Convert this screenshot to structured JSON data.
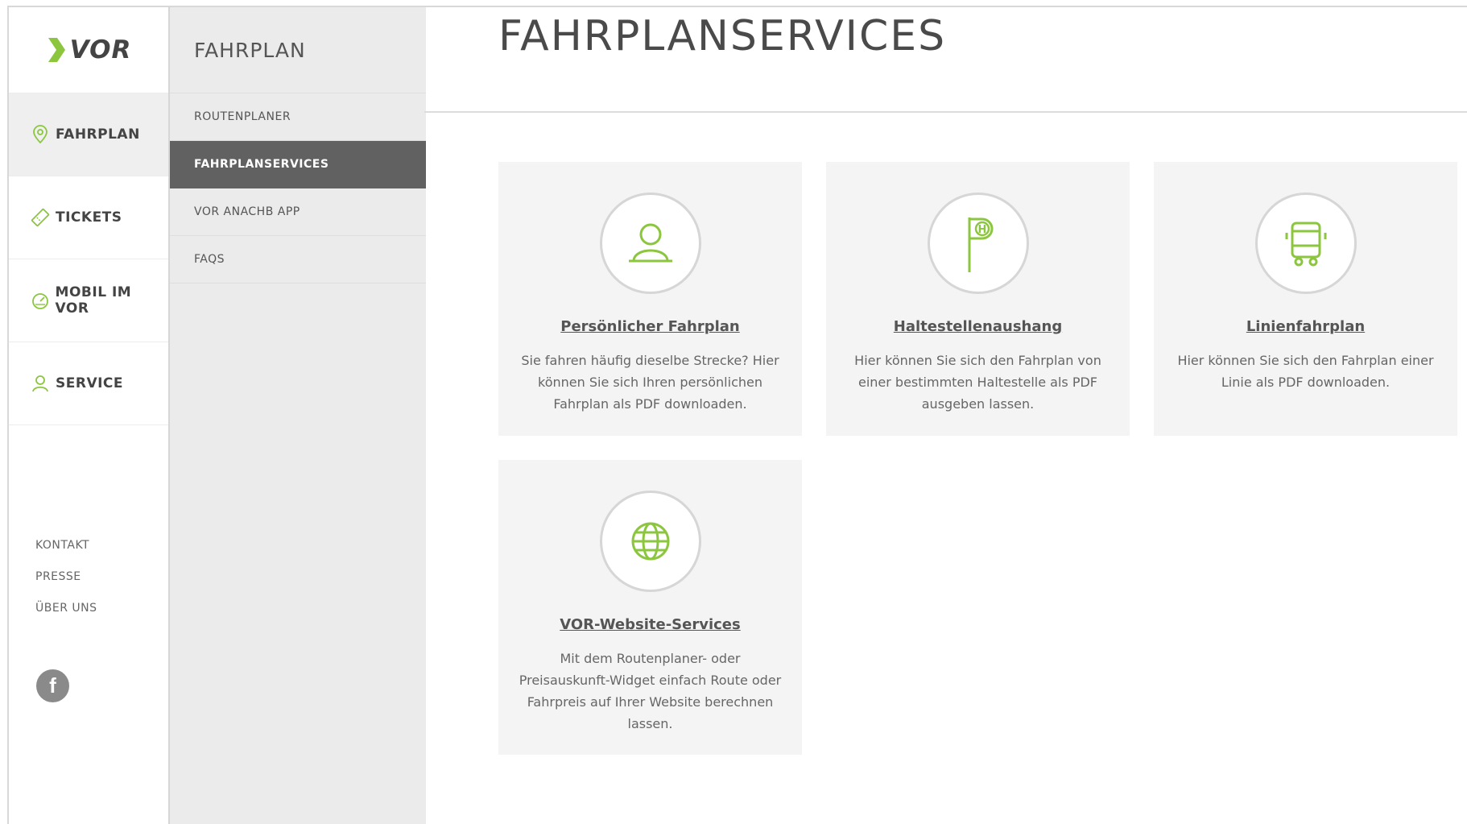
{
  "brand": {
    "logo_text": "VOR",
    "accent": "#8cc63f"
  },
  "primary_nav": [
    {
      "label": "FAHRPLAN",
      "icon": "location-pin-icon",
      "active": true
    },
    {
      "label": "TICKETS",
      "icon": "ticket-icon",
      "active": false
    },
    {
      "label": "MOBIL IM VOR",
      "icon": "speedometer-icon",
      "active": false
    },
    {
      "label": "SERVICE",
      "icon": "person-icon",
      "active": false
    }
  ],
  "footer_links": [
    "KONTAKT",
    "PRESSE",
    "ÜBER UNS"
  ],
  "social": {
    "facebook": "f"
  },
  "subnav": {
    "title": "FAHRPLAN",
    "items": [
      {
        "label": "ROUTENPLANER",
        "active": false
      },
      {
        "label": "FAHRPLANSERVICES",
        "active": true
      },
      {
        "label": "VOR ANACHB APP",
        "active": false
      },
      {
        "label": "FAQS",
        "active": false
      }
    ]
  },
  "main": {
    "title": "FAHRPLANSERVICES",
    "cards": [
      {
        "title": "Persönlicher Fahrplan",
        "icon": "person-icon",
        "desc": "Sie fahren häufig dieselbe Strecke? Hier können Sie sich Ihren persönlichen Fahrplan als PDF downloaden."
      },
      {
        "title": "Haltestellenaushang",
        "icon": "bus-stop-sign-icon",
        "icon_text": "H",
        "desc": "Hier können Sie sich den Fahrplan von einer bestimmten Haltestelle als PDF ausgeben lassen."
      },
      {
        "title": "Linienfahrplan",
        "icon": "bus-icon",
        "desc": "Hier können Sie sich den Fahrplan einer Linie als PDF downloaden."
      },
      {
        "title": "VOR-Website-Services",
        "icon": "globe-icon",
        "desc": "Mit dem Routenplaner- oder Preisauskunft-Widget einfach Route oder Fahrpreis auf Ihrer Website berechnen lassen."
      }
    ]
  }
}
